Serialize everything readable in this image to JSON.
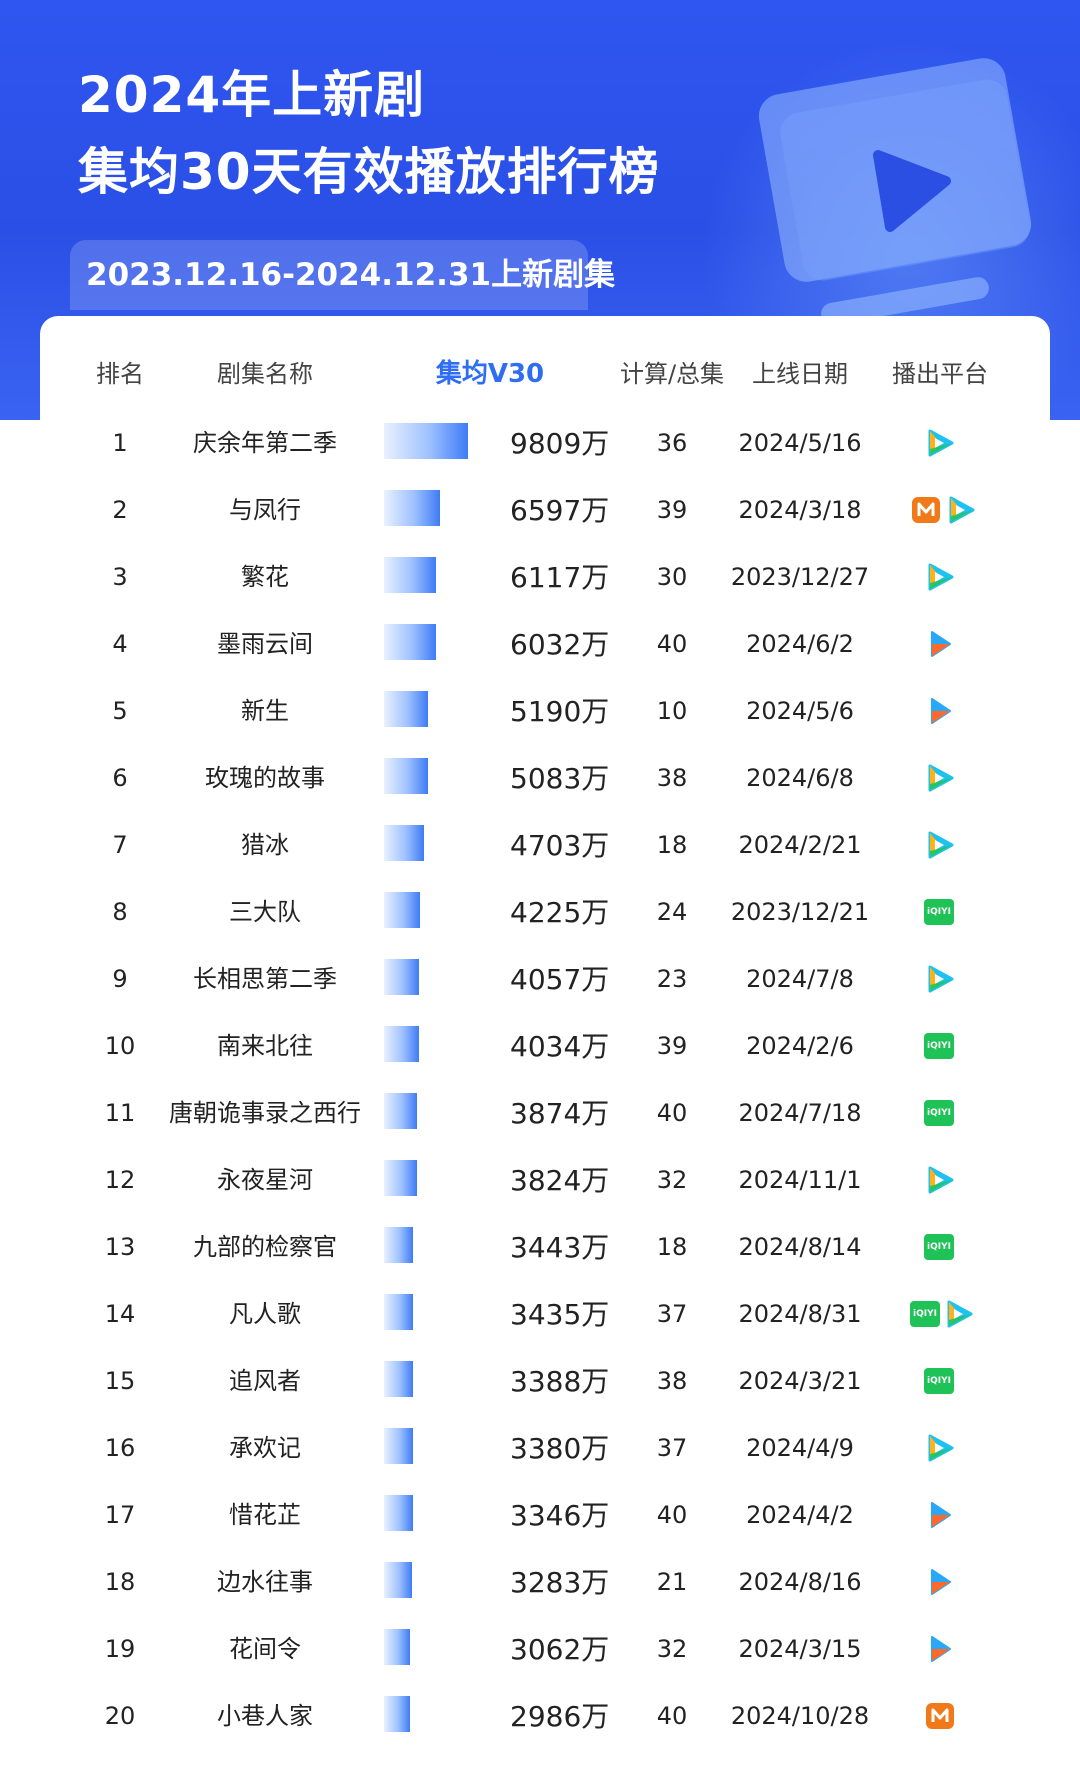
{
  "header": {
    "title_line1": "2024年上新剧",
    "title_line2": "集均30天有效播放排行榜",
    "date_range": "2023.12.16-2024.12.31上新剧集"
  },
  "table": {
    "columns": [
      "排名",
      "剧集名称",
      "集均V30",
      "计算/总集",
      "上线日期",
      "播出平台"
    ]
  },
  "chart_data": {
    "type": "bar",
    "title": "集均30天有效播放排行榜",
    "value_label": "集均V30",
    "unit": "万",
    "categories": [
      "庆余年第二季",
      "与凤行",
      "繁花",
      "墨雨云间",
      "新生",
      "玫瑰的故事",
      "猎冰",
      "三大队",
      "长相思第二季",
      "南来北往",
      "唐朝诡事录之西行",
      "永夜星河",
      "九部的检察官",
      "凡人歌",
      "追风者",
      "承欢记",
      "惜花芷",
      "边水往事",
      "花间令",
      "小巷人家"
    ],
    "values": [
      9809,
      6597,
      6117,
      6032,
      5190,
      5083,
      4703,
      4225,
      4057,
      4034,
      3874,
      3824,
      3443,
      3435,
      3388,
      3380,
      3346,
      3283,
      3062,
      2986
    ]
  },
  "rows": [
    {
      "rank": "1",
      "name": "庆余年第二季",
      "value": "9809万",
      "episodes": "36",
      "date": "2024/5/16",
      "platforms": [
        "tencent"
      ]
    },
    {
      "rank": "2",
      "name": "与凤行",
      "value": "6597万",
      "episodes": "39",
      "date": "2024/3/18",
      "platforms": [
        "mango",
        "tencent"
      ]
    },
    {
      "rank": "3",
      "name": "繁花",
      "value": "6117万",
      "episodes": "30",
      "date": "2023/12/27",
      "platforms": [
        "tencent"
      ]
    },
    {
      "rank": "4",
      "name": "墨雨云间",
      "value": "6032万",
      "episodes": "40",
      "date": "2024/6/2",
      "platforms": [
        "youku"
      ]
    },
    {
      "rank": "5",
      "name": "新生",
      "value": "5190万",
      "episodes": "10",
      "date": "2024/5/6",
      "platforms": [
        "youku"
      ]
    },
    {
      "rank": "6",
      "name": "玫瑰的故事",
      "value": "5083万",
      "episodes": "38",
      "date": "2024/6/8",
      "platforms": [
        "tencent"
      ]
    },
    {
      "rank": "7",
      "name": "猎冰",
      "value": "4703万",
      "episodes": "18",
      "date": "2024/2/21",
      "platforms": [
        "tencent"
      ]
    },
    {
      "rank": "8",
      "name": "三大队",
      "value": "4225万",
      "episodes": "24",
      "date": "2023/12/21",
      "platforms": [
        "iqiyi"
      ]
    },
    {
      "rank": "9",
      "name": "长相思第二季",
      "value": "4057万",
      "episodes": "23",
      "date": "2024/7/8",
      "platforms": [
        "tencent"
      ]
    },
    {
      "rank": "10",
      "name": "南来北往",
      "value": "4034万",
      "episodes": "39",
      "date": "2024/2/6",
      "platforms": [
        "iqiyi"
      ]
    },
    {
      "rank": "11",
      "name": "唐朝诡事录之西行",
      "value": "3874万",
      "episodes": "40",
      "date": "2024/7/18",
      "platforms": [
        "iqiyi"
      ]
    },
    {
      "rank": "12",
      "name": "永夜星河",
      "value": "3824万",
      "episodes": "32",
      "date": "2024/11/1",
      "platforms": [
        "tencent"
      ]
    },
    {
      "rank": "13",
      "name": "九部的检察官",
      "value": "3443万",
      "episodes": "18",
      "date": "2024/8/14",
      "platforms": [
        "iqiyi"
      ]
    },
    {
      "rank": "14",
      "name": "凡人歌",
      "value": "3435万",
      "episodes": "37",
      "date": "2024/8/31",
      "platforms": [
        "iqiyi",
        "tencent"
      ]
    },
    {
      "rank": "15",
      "name": "追风者",
      "value": "3388万",
      "episodes": "38",
      "date": "2024/3/21",
      "platforms": [
        "iqiyi"
      ]
    },
    {
      "rank": "16",
      "name": "承欢记",
      "value": "3380万",
      "episodes": "37",
      "date": "2024/4/9",
      "platforms": [
        "tencent"
      ]
    },
    {
      "rank": "17",
      "name": "惜花芷",
      "value": "3346万",
      "episodes": "40",
      "date": "2024/4/2",
      "platforms": [
        "youku"
      ]
    },
    {
      "rank": "18",
      "name": "边水往事",
      "value": "3283万",
      "episodes": "21",
      "date": "2024/8/16",
      "platforms": [
        "youku"
      ]
    },
    {
      "rank": "19",
      "name": "花间令",
      "value": "3062万",
      "episodes": "32",
      "date": "2024/3/15",
      "platforms": [
        "youku"
      ]
    },
    {
      "rank": "20",
      "name": "小巷人家",
      "value": "2986万",
      "episodes": "40",
      "date": "2024/10/28",
      "platforms": [
        "mango"
      ]
    }
  ],
  "platform_icons": {
    "tencent": {
      "icon": "tencent-video-icon",
      "label": ""
    },
    "youku": {
      "icon": "youku-icon",
      "label": ""
    },
    "iqiyi": {
      "icon": "iqiyi-icon",
      "label": "iQIYI"
    },
    "mango": {
      "icon": "mango-tv-icon",
      "label": "M"
    }
  },
  "colors": {
    "hero": "#2f56f0",
    "accent": "#2f6ef2",
    "bar_end": "#3e7bf5",
    "iqiyi": "#1ec256",
    "mango": "#f07a1a"
  }
}
